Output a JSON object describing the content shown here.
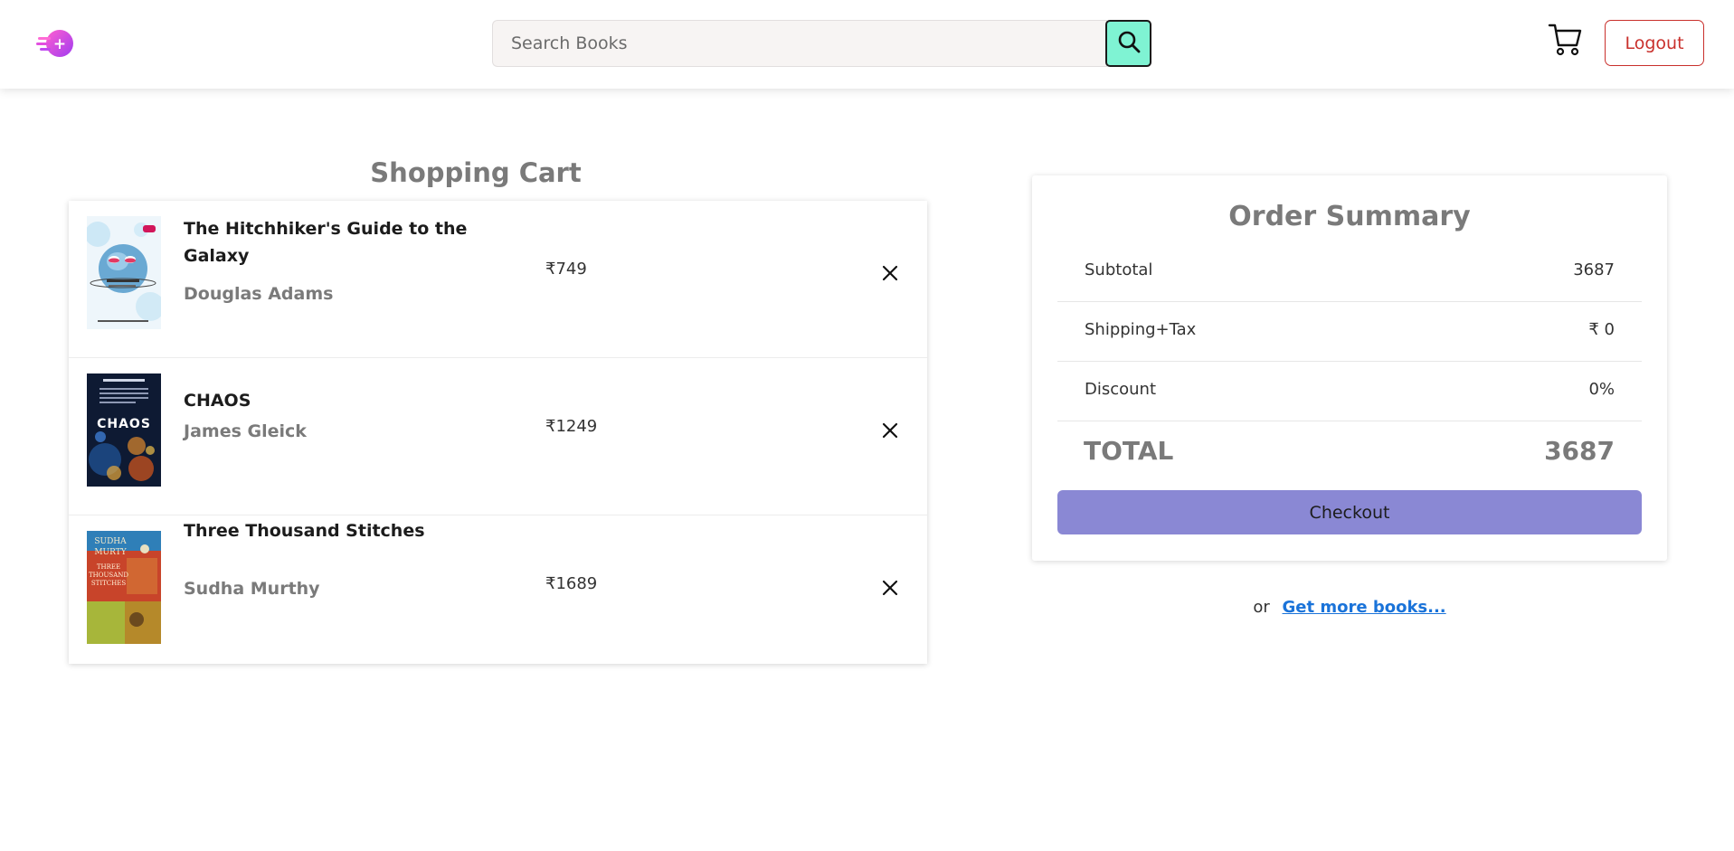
{
  "header": {
    "logo_icon": "bookstore-logo-icon",
    "search": {
      "placeholder": "Search Books",
      "value": ""
    },
    "search_icon": "search-icon",
    "cart_icon": "shopping-cart-icon",
    "logout_label": "Logout"
  },
  "cart": {
    "title": "Shopping Cart",
    "items": [
      {
        "title": "The Hitchhiker's Guide to the Galaxy",
        "author": "Douglas Adams",
        "price": "₹749",
        "remove_icon": "close-icon"
      },
      {
        "title": "CHAOS",
        "author": "James Gleick",
        "price": "₹1249",
        "remove_icon": "close-icon"
      },
      {
        "title": "Three Thousand Stitches",
        "author": "Sudha Murthy",
        "price": "₹1689",
        "remove_icon": "close-icon"
      }
    ]
  },
  "summary": {
    "title": "Order Summary",
    "rows": [
      {
        "label": "Subtotal",
        "value": "3687"
      },
      {
        "label": "Shipping+Tax",
        "value": "₹ 0"
      },
      {
        "label": "Discount",
        "value": "0%"
      }
    ],
    "total_label": "TOTAL",
    "total_value": "3687",
    "checkout_label": "Checkout"
  },
  "footer": {
    "or_text": "or",
    "more_link": "Get more books..."
  },
  "colors": {
    "accent_search": "#7ff3d3",
    "checkout": "#8a88d4",
    "logout": "#c9302c",
    "link": "#1a73d9"
  }
}
